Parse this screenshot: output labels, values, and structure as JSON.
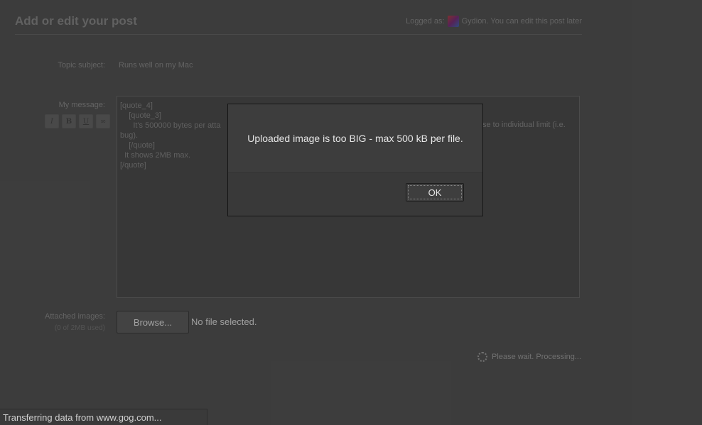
{
  "header": {
    "title": "Add or edit your post",
    "logged_as_prefix": "Logged as:",
    "logged_as_suffix": "Gydion. You can edit this post later"
  },
  "form": {
    "topic_label": "Topic subject:",
    "topic_value": "Runs well on my Mac",
    "message_label": "My message:",
    "format_buttons": [
      "I",
      "B",
      "U",
      "∞"
    ],
    "message_lines": [
      "[quote_4]",
      "    [quote_3]",
      "      It's 500000 bytes per atta",
      "bug).",
      "    [/quote]",
      "  It shows 2MB max.",
      "[/quote]"
    ],
    "message_right_fragment": "se to individual limit (i.e.",
    "attached_label": "Attached images:",
    "attached_sublabel": "(0 of 2MB used)",
    "browse_label": "Browse...",
    "no_file_label": "No file selected.",
    "processing_label": "Please wait. Processing..."
  },
  "status_bar": {
    "text": "Transferring data from www.gog.com..."
  },
  "dialog": {
    "message": "Uploaded image is too BIG - max 500 kB per file.",
    "ok_label": "OK"
  }
}
